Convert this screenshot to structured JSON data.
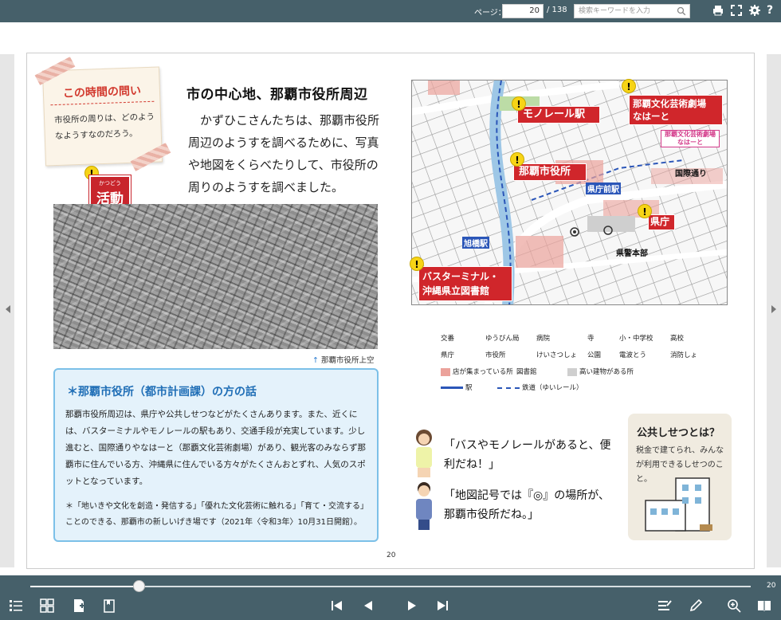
{
  "toolbar": {
    "page_label": "ページ：",
    "page_value": "20",
    "page_total": "/ 138",
    "search_placeholder": "検索キーワードを入力",
    "icons": [
      "print-icon",
      "fullscreen-icon",
      "settings-icon",
      "help-icon"
    ]
  },
  "page": {
    "note_title": "この時間の問い",
    "note_body": "市役所の周りは、どのようなようすなのだろう。",
    "activity_ruby": "かつどう",
    "activity_label": "活動",
    "heading": "市の中心地、那覇市役所周辺",
    "body": "かずひこさんたちは、那覇市役所周辺のようすを調べるために、写真や地図をくらべたりして、市役所の周りのようすを調べました。",
    "photo_caption": "那覇市役所上空",
    "talk_title": "＊那覇市役所（都市計画課）の方の話",
    "talk_body": "那覇市役所周辺は、県庁や公共しせつなどがたくさんあります。また、近くには、バスターミナルやモノレールの駅もあり、交通手段が充実しています。少し進むと、国際通りやなはーと（那覇文化芸術劇場）があり、観光客のみならず那覇市に住んでいる方、沖縄県に住んでいる方々がたくさんおとずれ、人気のスポットとなっています。",
    "talk_note": "＊「地いきや文化を創造・発信する」「優れた文化芸術に触れる」「育て・交流する」ことのできる、那覇市の新しいげき場です（2021年〈令和3年〉10月31日開館）。",
    "map_labels": {
      "monorail": "モノレール駅",
      "theater": "那覇文化芸術劇場\nなはーと",
      "cityhall": "那覇市役所",
      "pref": "県庁",
      "bus": "バスターミナル・\n沖縄県立図書館",
      "kokusai": "国際通り",
      "asahibashi": "旭橋駅",
      "kencho_mae": "県庁前駅",
      "police": "県警本部",
      "nahaato_sign": "那覇文化芸術劇場\nなはーと"
    },
    "legend": [
      [
        "交番",
        "ゆうびん局",
        "病院",
        "寺",
        "小・中学校",
        "高校"
      ],
      [
        "県庁",
        "市役所",
        "けいさつしょ",
        "公園",
        "電波とう",
        "消防しょ"
      ],
      [
        "店が集まっている所",
        "図書館",
        "高い建物がある所"
      ],
      [
        "駅",
        "鉄道（ゆいレール）"
      ]
    ],
    "speech1": "「バスやモノレールがあると、便利だね！」",
    "speech2": "「地図記号では『◎』の場所が、那覇市役所だね。」",
    "public_title": "公共しせつとは？",
    "public_body": "税金で建てられ、みんなが利用できるしせつのこと。",
    "page_number": "20"
  },
  "bottombar": {
    "slider_value": "20",
    "icons": [
      "toc-icon",
      "thumbnails-icon",
      "bookmark-add-icon",
      "bookmark-list-icon",
      "first-page-icon",
      "prev-page-icon",
      "next-page-icon",
      "last-page-icon",
      "highlight-icon",
      "pen-icon",
      "zoom-in-icon",
      "spread-view-icon"
    ]
  },
  "colors": {
    "bar": "#46606a",
    "red": "#d0262b",
    "yellow": "#f7d416",
    "blue": "#1f6eb6"
  }
}
